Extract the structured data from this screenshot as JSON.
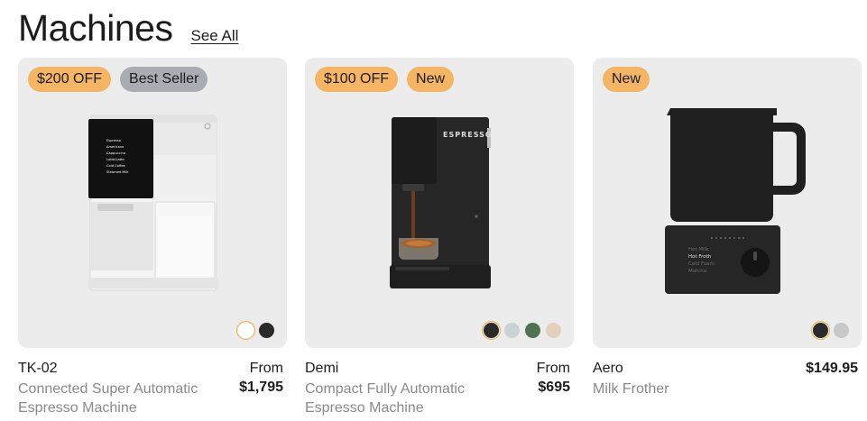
{
  "header": {
    "title": "Machines",
    "see_all": "See All"
  },
  "products": [
    {
      "badges": [
        "$200 OFF",
        "Best Seller"
      ],
      "name": "TK-02",
      "subtitle": "Connected Super Automatic Espresso Machine",
      "price_label": "From",
      "price": "$1,795",
      "screen_menu": [
        "Espresso",
        "Americano",
        "Cappuccino",
        "Latte/Latte",
        "Cold Coffee",
        "Steamed Milk"
      ],
      "swatches": [
        {
          "color": "#ffffff",
          "selected": true
        },
        {
          "color": "#2a2a2a",
          "selected": false
        }
      ]
    },
    {
      "badges": [
        "$100 OFF",
        "New"
      ],
      "name": "Demi",
      "subtitle": "Compact Fully Automatic Espresso Machine",
      "price_label": "From",
      "price": "$695",
      "machine_label": "ESPRESSO",
      "swatches": [
        {
          "color": "#2a2a2a",
          "selected": true
        },
        {
          "color": "#c9d2d6",
          "selected": false
        },
        {
          "color": "#4f7350",
          "selected": false
        },
        {
          "color": "#e5cfbd",
          "selected": false
        }
      ]
    },
    {
      "badges": [
        "New"
      ],
      "name": "Aero",
      "subtitle": "Milk Frother",
      "price": "$149.95",
      "frother_modes": [
        "Hot Milk",
        "Hot Froth",
        "Cold Foam",
        "Matcha"
      ],
      "swatches": [
        {
          "color": "#2a2a2a",
          "selected": true
        },
        {
          "color": "#c8c8c8",
          "selected": false
        }
      ]
    }
  ]
}
